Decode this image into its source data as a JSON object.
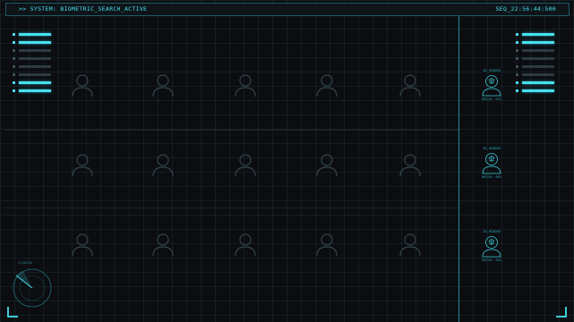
{
  "header": {
    "status_text": ">> SYSTEM: BIOMETRIC_SEARCH_ACTIVE",
    "sequence_text": "SEQ_22:56:44:500"
  },
  "left_menu": {
    "items": [
      {
        "state": "on"
      },
      {
        "state": "on"
      },
      {
        "state": "off"
      },
      {
        "state": "off"
      },
      {
        "state": "off"
      },
      {
        "state": "off"
      },
      {
        "state": "on"
      },
      {
        "state": "on"
      }
    ]
  },
  "right_menu": {
    "items": [
      {
        "state": "on"
      },
      {
        "state": "on"
      },
      {
        "state": "off"
      },
      {
        "state": "off"
      },
      {
        "state": "off"
      },
      {
        "state": "off"
      },
      {
        "state": "on"
      },
      {
        "state": "on"
      }
    ]
  },
  "results": [
    {
      "id": "ID_HIDDEN",
      "match": "MATCH: 97%"
    },
    {
      "id": "ID_HIDDEN",
      "match": "MATCH: 96%"
    },
    {
      "id": "ID_HIDDEN",
      "match": "MATCH: 94%"
    }
  ],
  "radar": {
    "label": "SCANNING"
  },
  "colors": {
    "accent": "#46e0f0",
    "panel_border": "#1f5a66",
    "background": "#0b0d10"
  },
  "icons": {
    "candidate": "user-silhouette-icon",
    "result": "face-mesh-icon",
    "radar": "radar-sweep-icon"
  }
}
